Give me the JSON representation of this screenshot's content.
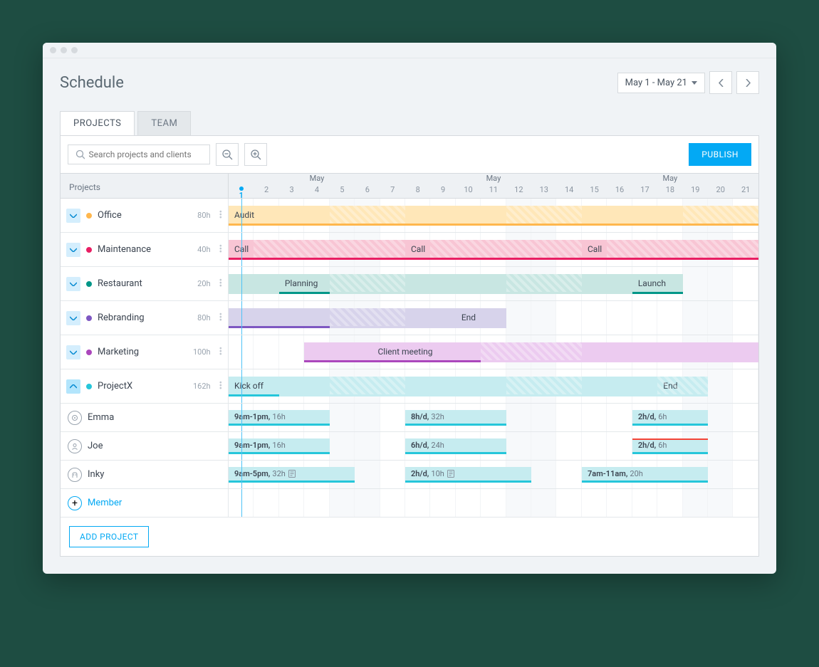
{
  "page_title": "Schedule",
  "date_range": "May 1 - May 21",
  "tabs": {
    "projects": "PROJECTS",
    "team": "TEAM"
  },
  "search": {
    "placeholder": "Search projects and clients"
  },
  "publish_label": "PUBLISH",
  "header_label": "Projects",
  "month_label": "May",
  "days": [
    1,
    2,
    3,
    4,
    5,
    6,
    7,
    8,
    9,
    10,
    11,
    12,
    13,
    14,
    15,
    16,
    17,
    18,
    19,
    20,
    21
  ],
  "weekend_days": [
    5,
    6,
    12,
    13,
    19,
    20
  ],
  "today": 1,
  "projects": [
    {
      "name": "Office",
      "hours": "80h",
      "color": "#ffb74d",
      "chev": "down",
      "bars": [
        {
          "start": 1,
          "end": 5,
          "label": "Audit",
          "bg": "#ffe7b8",
          "border": "#ffb74d",
          "hatched": false
        },
        {
          "start": 5,
          "end": 7,
          "label": "",
          "bg": "#ffe7b8",
          "border": "#ffb74d",
          "hatched": true
        },
        {
          "start": 8,
          "end": 12,
          "label": "",
          "bg": "#ffe7b8",
          "border": "#ffb74d",
          "hatched": false
        },
        {
          "start": 12,
          "end": 14,
          "label": "",
          "bg": "#ffe7b8",
          "border": "#ffb74d",
          "hatched": true
        },
        {
          "start": 15,
          "end": 19,
          "label": "",
          "bg": "#ffe7b8",
          "border": "#ffb74d",
          "hatched": false
        },
        {
          "start": 19,
          "end": 21,
          "label": "",
          "bg": "#ffe7b8",
          "border": "#ffb74d",
          "hatched": true
        }
      ]
    },
    {
      "name": "Maintenance",
      "hours": "40h",
      "color": "#e91e63",
      "chev": "down",
      "bars": [
        {
          "start": 1,
          "end": 2,
          "label": "Call",
          "bg": "#f8c5d4",
          "border": "#e91e63",
          "hatched": false
        },
        {
          "start": 2,
          "end": 7,
          "label": "",
          "bg": "#f8c5d4",
          "border": "#e91e63",
          "hatched": true
        },
        {
          "start": 8,
          "end": 9,
          "label": "Call",
          "bg": "#f8c5d4",
          "border": "#e91e63",
          "hatched": false
        },
        {
          "start": 9,
          "end": 14,
          "label": "",
          "bg": "#f8c5d4",
          "border": "#e91e63",
          "hatched": true
        },
        {
          "start": 15,
          "end": 16,
          "label": "Call",
          "bg": "#f8c5d4",
          "border": "#e91e63",
          "hatched": false
        },
        {
          "start": 16,
          "end": 21,
          "label": "",
          "bg": "#f8c5d4",
          "border": "#e91e63",
          "hatched": true
        }
      ]
    },
    {
      "name": "Restaurant",
      "hours": "20h",
      "color": "#009688",
      "chev": "down",
      "bars": [
        {
          "start": 1,
          "end": 2,
          "label": "",
          "bg": "#c8e6e2",
          "border": "#c8e6e2",
          "hatched": false
        },
        {
          "start": 3,
          "end": 5,
          "label": "Planning",
          "bg": "#c8e6e2",
          "border": "#009688",
          "hatched": false
        },
        {
          "start": 5,
          "end": 7,
          "label": "",
          "bg": "#c8e6e2",
          "border": "#c8e6e2",
          "hatched": true
        },
        {
          "start": 8,
          "end": 12,
          "label": "",
          "bg": "#c8e6e2",
          "border": "#c8e6e2",
          "hatched": false
        },
        {
          "start": 12,
          "end": 14,
          "label": "",
          "bg": "#c8e6e2",
          "border": "#c8e6e2",
          "hatched": true
        },
        {
          "start": 15,
          "end": 16,
          "label": "",
          "bg": "#c8e6e2",
          "border": "#c8e6e2",
          "hatched": false
        },
        {
          "start": 17,
          "end": 18,
          "label": "Launch",
          "bg": "#c8e6e2",
          "border": "#009688",
          "hatched": false
        }
      ]
    },
    {
      "name": "Rebranding",
      "hours": "80h",
      "color": "#7e57c2",
      "chev": "down",
      "bars": [
        {
          "start": 1,
          "end": 5,
          "label": "",
          "bg": "#d7d3eb",
          "border": "#7e57c2",
          "hatched": false
        },
        {
          "start": 5,
          "end": 7,
          "label": "",
          "bg": "#d7d3eb",
          "border": "#d7d3eb",
          "hatched": true
        },
        {
          "start": 8,
          "end": 10,
          "label": "",
          "bg": "#d7d3eb",
          "border": "#d7d3eb",
          "hatched": false
        },
        {
          "start": 10,
          "end": 11,
          "label": "End",
          "bg": "#d7d3eb",
          "border": "#d7d3eb",
          "hatched": false
        }
      ]
    },
    {
      "name": "Marketing",
      "hours": "100h",
      "color": "#ab47bc",
      "chev": "down",
      "bars": [
        {
          "start": 4,
          "end": 11,
          "label": "Client meeting",
          "bg": "#eccbf0",
          "border": "#ab47bc",
          "center": true,
          "hatched": false
        },
        {
          "start": 11,
          "end": 14,
          "label": "",
          "bg": "#eccbf0",
          "border": "#eccbf0",
          "hatched": true
        },
        {
          "start": 15,
          "end": 21,
          "label": "",
          "bg": "#eccbf0",
          "border": "#eccbf0",
          "hatched": false
        }
      ]
    },
    {
      "name": "ProjectX",
      "hours": "162h",
      "color": "#26c6da",
      "chev": "up",
      "bars": [
        {
          "start": 1,
          "end": 3,
          "label": "Kick off",
          "bg": "#c6ecf0",
          "border": "#26c6da",
          "hatched": false
        },
        {
          "start": 3,
          "end": 5,
          "label": "",
          "bg": "#c6ecf0",
          "border": "#c6ecf0",
          "hatched": false
        },
        {
          "start": 5,
          "end": 7,
          "label": "",
          "bg": "#c6ecf0",
          "border": "#c6ecf0",
          "hatched": true
        },
        {
          "start": 8,
          "end": 12,
          "label": "",
          "bg": "#c6ecf0",
          "border": "#c6ecf0",
          "hatched": false
        },
        {
          "start": 12,
          "end": 14,
          "label": "",
          "bg": "#c6ecf0",
          "border": "#c6ecf0",
          "hatched": true
        },
        {
          "start": 15,
          "end": 18,
          "label": "",
          "bg": "#c6ecf0",
          "border": "#c6ecf0",
          "hatched": false
        },
        {
          "start": 18,
          "end": 19,
          "label": "End",
          "bg": "#c6ecf0",
          "border": "#c6ecf0",
          "hatched": true
        }
      ],
      "members": [
        {
          "name": "Emma",
          "icon": "target",
          "bars": [
            {
              "start": 1,
              "end": 4,
              "bold": "9am-1pm,",
              "light": "16h",
              "bg": "#c6ecf0",
              "border": "#26c6da"
            },
            {
              "start": 8,
              "end": 11,
              "bold": "8h/d,",
              "light": "32h",
              "bg": "#c6ecf0",
              "border": "#26c6da"
            },
            {
              "start": 17,
              "end": 19,
              "bold": "2h/d,",
              "light": "6h",
              "bg": "#c6ecf0",
              "border": "#26c6da"
            }
          ]
        },
        {
          "name": "Joe",
          "icon": "person",
          "bars": [
            {
              "start": 1,
              "end": 4,
              "bold": "9am-1pm,",
              "light": "16h",
              "bg": "#c6ecf0",
              "border": "#26c6da"
            },
            {
              "start": 8,
              "end": 11,
              "bold": "6h/d,",
              "light": "24h",
              "bg": "#c6ecf0",
              "border": "#26c6da"
            },
            {
              "start": 17,
              "end": 19,
              "bold": "2h/d,",
              "light": "6h",
              "bg": "#c6ecf0",
              "border": "#26c6da",
              "redtop": true
            }
          ]
        },
        {
          "name": "Inky",
          "icon": "robot",
          "bars": [
            {
              "start": 1,
              "end": 5,
              "bold": "9am-5pm,",
              "light": "32h",
              "bg": "#c6ecf0",
              "border": "#26c6da",
              "note": true
            },
            {
              "start": 8,
              "end": 12,
              "bold": "2h/d,",
              "light": "10h",
              "bg": "#c6ecf0",
              "border": "#26c6da",
              "note": true
            },
            {
              "start": 15,
              "end": 19,
              "bold": "7am-11am,",
              "light": "20h",
              "bg": "#c6ecf0",
              "border": "#26c6da"
            }
          ]
        }
      ]
    }
  ],
  "add_member_label": "Member",
  "add_project_label": "ADD PROJECT"
}
